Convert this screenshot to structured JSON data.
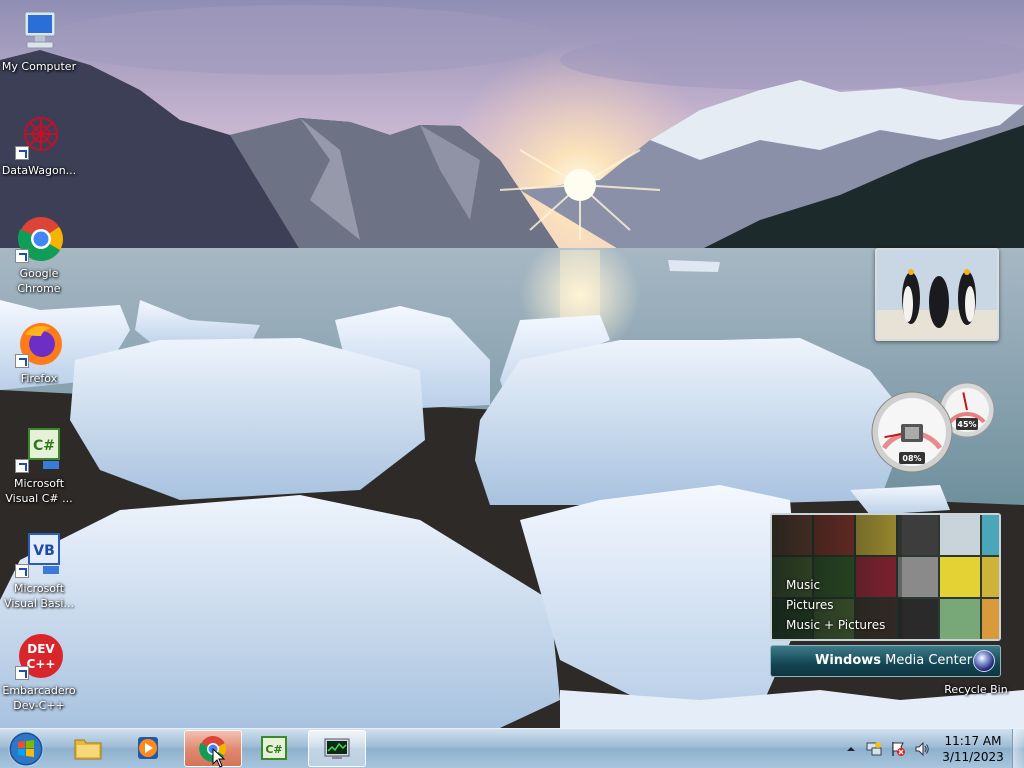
{
  "desktop": {
    "icons": [
      {
        "label": "My Computer",
        "icon": "computer-icon"
      },
      {
        "label": "DataWagon...",
        "icon": "datawagon-icon"
      },
      {
        "label": "Google Chrome",
        "icon": "chrome-icon"
      },
      {
        "label": "Firefox",
        "icon": "firefox-icon"
      },
      {
        "label": "Microsoft Visual C# ...",
        "icon": "visual-csharp-icon"
      },
      {
        "label": "Microsoft Visual Basi...",
        "icon": "visual-basic-icon"
      },
      {
        "label": "Embarcadero Dev-C++",
        "icon": "dev-cpp-icon"
      },
      {
        "label": "Recycle Bin",
        "icon": "recycle-bin-icon"
      }
    ]
  },
  "gadgets": {
    "cpu_meter": {
      "cpu_percent": "08%",
      "memory_percent": "45%",
      "cpu_value": 0.08,
      "memory_value": 0.45
    },
    "media_center": {
      "menu": [
        "Music",
        "Pictures",
        "Music + Pictures"
      ],
      "brand_bold": "Windows",
      "brand_rest": " Media Center"
    }
  },
  "taskbar": {
    "pinned": [
      {
        "name": "Windows Explorer",
        "icon": "folder-icon",
        "state": "pinned"
      },
      {
        "name": "Windows Media Player",
        "icon": "media-player-icon",
        "state": "pinned"
      },
      {
        "name": "Google Chrome",
        "icon": "chrome-icon",
        "state": "active"
      },
      {
        "name": "Visual C#",
        "icon": "visual-csharp-icon",
        "state": "pinned"
      },
      {
        "name": "Task Manager",
        "icon": "monitor-icon",
        "state": "open"
      }
    ],
    "clock": {
      "time": "11:17 AM",
      "date": "3/11/2023"
    }
  },
  "colors": {
    "taskbar": "#9fbcd6",
    "active_button": "#e08b72",
    "sky": "#b9a6c8",
    "water": "#7f9fae"
  }
}
